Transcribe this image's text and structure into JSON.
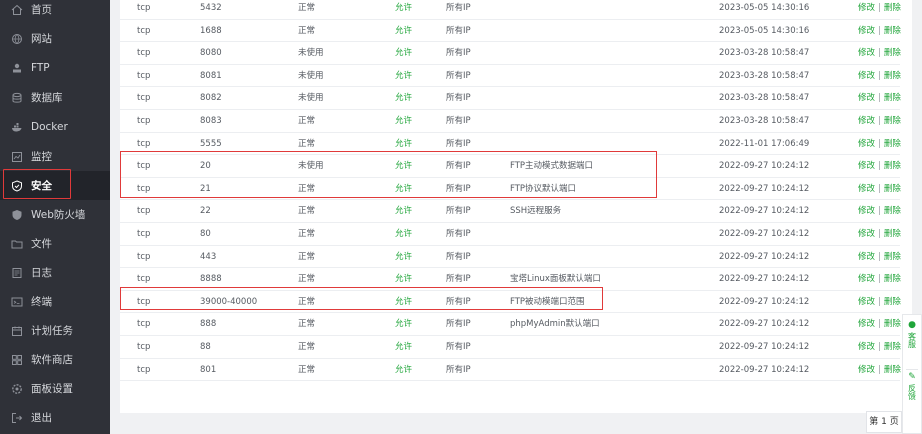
{
  "sidebar": {
    "items": [
      {
        "label": "首页",
        "icon": "home-icon"
      },
      {
        "label": "网站",
        "icon": "globe-icon"
      },
      {
        "label": "FTP",
        "icon": "ftp-icon"
      },
      {
        "label": "数据库",
        "icon": "database-icon"
      },
      {
        "label": "Docker",
        "icon": "docker-icon"
      },
      {
        "label": "监控",
        "icon": "monitor-icon"
      },
      {
        "label": "安全",
        "icon": "shield-icon",
        "active": true
      },
      {
        "label": "Web防火墙",
        "icon": "firewall-icon"
      },
      {
        "label": "文件",
        "icon": "folder-icon"
      },
      {
        "label": "日志",
        "icon": "log-icon"
      },
      {
        "label": "终端",
        "icon": "terminal-icon"
      },
      {
        "label": "计划任务",
        "icon": "calendar-icon"
      },
      {
        "label": "软件商店",
        "icon": "grid-icon"
      },
      {
        "label": "面板设置",
        "icon": "settings-icon"
      },
      {
        "label": "退出",
        "icon": "logout-icon"
      }
    ]
  },
  "table": {
    "ops_edit": "修改",
    "ops_delete": "删除",
    "rows": [
      {
        "proto": "tcp",
        "port": "5432",
        "status": "正常",
        "action": "允许",
        "ip": "所有IP",
        "note": "",
        "time": "2023-05-05 14:30:16"
      },
      {
        "proto": "tcp",
        "port": "1688",
        "status": "正常",
        "action": "允许",
        "ip": "所有IP",
        "note": "",
        "time": "2023-05-05 14:30:16"
      },
      {
        "proto": "tcp",
        "port": "8080",
        "status": "未使用",
        "action": "允许",
        "ip": "所有IP",
        "note": "",
        "time": "2023-03-28 10:58:47"
      },
      {
        "proto": "tcp",
        "port": "8081",
        "status": "未使用",
        "action": "允许",
        "ip": "所有IP",
        "note": "",
        "time": "2023-03-28 10:58:47"
      },
      {
        "proto": "tcp",
        "port": "8082",
        "status": "未使用",
        "action": "允许",
        "ip": "所有IP",
        "note": "",
        "time": "2023-03-28 10:58:47"
      },
      {
        "proto": "tcp",
        "port": "8083",
        "status": "正常",
        "action": "允许",
        "ip": "所有IP",
        "note": "",
        "time": "2023-03-28 10:58:47"
      },
      {
        "proto": "tcp",
        "port": "5555",
        "status": "正常",
        "action": "允许",
        "ip": "所有IP",
        "note": "",
        "time": "2022-11-01 17:06:49"
      },
      {
        "proto": "tcp",
        "port": "20",
        "status": "未使用",
        "action": "允许",
        "ip": "所有IP",
        "note": "FTP主动模式数据端口",
        "time": "2022-09-27 10:24:12"
      },
      {
        "proto": "tcp",
        "port": "21",
        "status": "正常",
        "action": "允许",
        "ip": "所有IP",
        "note": "FTP协议默认端口",
        "time": "2022-09-27 10:24:12"
      },
      {
        "proto": "tcp",
        "port": "22",
        "status": "正常",
        "action": "允许",
        "ip": "所有IP",
        "note": "SSH远程服务",
        "time": "2022-09-27 10:24:12"
      },
      {
        "proto": "tcp",
        "port": "80",
        "status": "正常",
        "action": "允许",
        "ip": "所有IP",
        "note": "",
        "time": "2022-09-27 10:24:12"
      },
      {
        "proto": "tcp",
        "port": "443",
        "status": "正常",
        "action": "允许",
        "ip": "所有IP",
        "note": "",
        "time": "2022-09-27 10:24:12"
      },
      {
        "proto": "tcp",
        "port": "8888",
        "status": "正常",
        "action": "允许",
        "ip": "所有IP",
        "note": "宝塔Linux面板默认端口",
        "time": "2022-09-27 10:24:12"
      },
      {
        "proto": "tcp",
        "port": "39000-40000",
        "status": "正常",
        "action": "允许",
        "ip": "所有IP",
        "note": "FTP被动模端口范围",
        "time": "2022-09-27 10:24:12"
      },
      {
        "proto": "tcp",
        "port": "888",
        "status": "正常",
        "action": "允许",
        "ip": "所有IP",
        "note": "phpMyAdmin默认端口",
        "time": "2022-09-27 10:24:12"
      },
      {
        "proto": "tcp",
        "port": "88",
        "status": "正常",
        "action": "允许",
        "ip": "所有IP",
        "note": "",
        "time": "2022-09-27 10:24:12"
      },
      {
        "proto": "tcp",
        "port": "801",
        "status": "正常",
        "action": "允许",
        "ip": "所有IP",
        "note": "",
        "time": "2022-09-27 10:24:12"
      }
    ]
  },
  "pager": {
    "label": "第 1 页"
  },
  "float": {
    "service_label": "客服",
    "feedback_label": "反馈",
    "service_icon": "headset-icon",
    "feedback_icon": "edit-icon"
  },
  "colors": {
    "accent": "#20a53a",
    "sidebar": "#2f3138",
    "highlight": "#e03a3a"
  }
}
